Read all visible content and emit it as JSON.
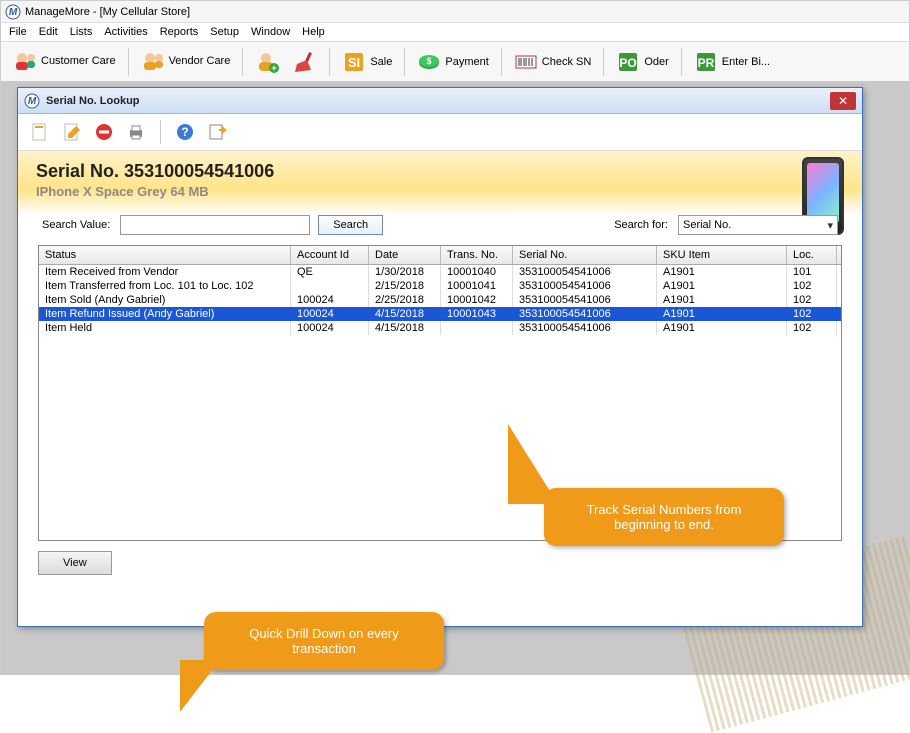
{
  "app": {
    "title": "ManageMore - [My Cellular Store]"
  },
  "menu": [
    "File",
    "Edit",
    "Lists",
    "Activities",
    "Reports",
    "Setup",
    "Window",
    "Help"
  ],
  "toolbar": [
    {
      "id": "customer-care",
      "label": "Customer Care"
    },
    {
      "id": "vendor-care",
      "label": "Vendor Care"
    },
    {
      "id": "add-user",
      "label": ""
    },
    {
      "id": "broom",
      "label": ""
    },
    {
      "id": "sale",
      "label": "Sale"
    },
    {
      "id": "payment",
      "label": "Payment"
    },
    {
      "id": "check-sn",
      "label": "Check SN"
    },
    {
      "id": "order",
      "label": "Oder"
    },
    {
      "id": "enter-bill",
      "label": "Enter Bi..."
    }
  ],
  "lookup": {
    "window_title": "Serial No. Lookup",
    "serial_label": "Serial No.",
    "serial_value": "353100054541006",
    "product_name": "IPhone X Space Grey 64 MB",
    "search_value_label": "Search Value:",
    "search_value": "",
    "search_button": "Search",
    "search_for_label": "Search for:",
    "search_for_value": "Serial No.",
    "columns": [
      "Status",
      "Account Id",
      "Date",
      "Trans. No.",
      "Serial No.",
      "SKU Item",
      "Loc."
    ],
    "rows": [
      {
        "status": "Item Received from Vendor",
        "account": "QE",
        "date": "1/30/2018",
        "trans": "10001040",
        "serial": "353100054541006",
        "sku": "A1901",
        "loc": "101",
        "selected": false
      },
      {
        "status": "Item Transferred from Loc. 101 to Loc. 102",
        "account": "",
        "date": "2/15/2018",
        "trans": "10001041",
        "serial": "353100054541006",
        "sku": "A1901",
        "loc": "102",
        "selected": false
      },
      {
        "status": "Item Sold (Andy Gabriel)",
        "account": "100024",
        "date": "2/25/2018",
        "trans": "10001042",
        "serial": "353100054541006",
        "sku": "A1901",
        "loc": "102",
        "selected": false
      },
      {
        "status": "Item Refund Issued (Andy Gabriel)",
        "account": "100024",
        "date": "4/15/2018",
        "trans": "10001043",
        "serial": "353100054541006",
        "sku": "A1901",
        "loc": "102",
        "selected": true
      },
      {
        "status": "Item Held",
        "account": "100024",
        "date": "4/15/2018",
        "trans": "",
        "serial": "353100054541006",
        "sku": "A1901",
        "loc": "102",
        "selected": false
      }
    ],
    "view_button": "View"
  },
  "callouts": {
    "track": "Track Serial Numbers from beginning to end.",
    "drill": "Quick Drill Down on every transaction"
  }
}
